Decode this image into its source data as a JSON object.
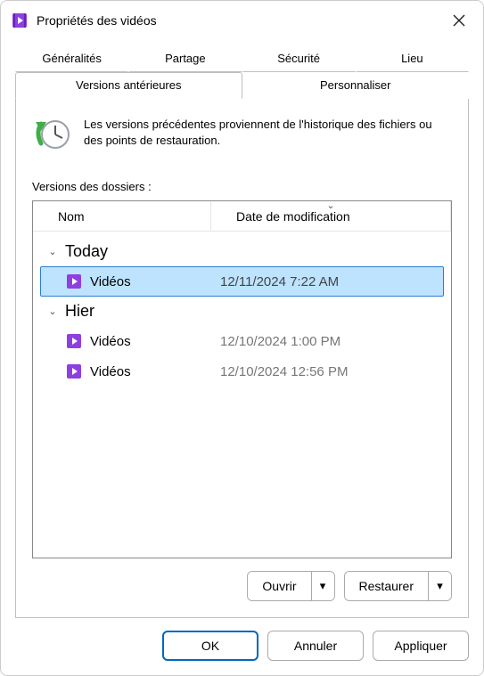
{
  "window": {
    "title": "Propriétés des vidéos"
  },
  "tabs": {
    "row1": [
      "Généralités",
      "Partage",
      "Sécurité",
      "Lieu"
    ],
    "row2": [
      "Versions antérieures",
      "Personnaliser"
    ],
    "active": "Versions antérieures"
  },
  "hint": "Les versions précédentes proviennent de l'historique des fichiers ou des points de restauration.",
  "list": {
    "label": "Versions des dossiers :",
    "columns": {
      "name": "Nom",
      "date": "Date de modification"
    },
    "groups": [
      {
        "label": "Today",
        "items": [
          {
            "name": "Vidéos",
            "date": "12/11/2024 7:22 AM",
            "selected": true
          }
        ]
      },
      {
        "label": "Hier",
        "items": [
          {
            "name": "Vidéos",
            "date": "12/10/2024 1:00 PM",
            "selected": false
          },
          {
            "name": "Vidéos",
            "date": "12/10/2024 12:56 PM",
            "selected": false
          }
        ]
      }
    ]
  },
  "actions": {
    "open": "Ouvrir",
    "restore": "Restaurer"
  },
  "buttons": {
    "ok": "OK",
    "cancel": "Annuler",
    "apply": "Appliquer"
  }
}
